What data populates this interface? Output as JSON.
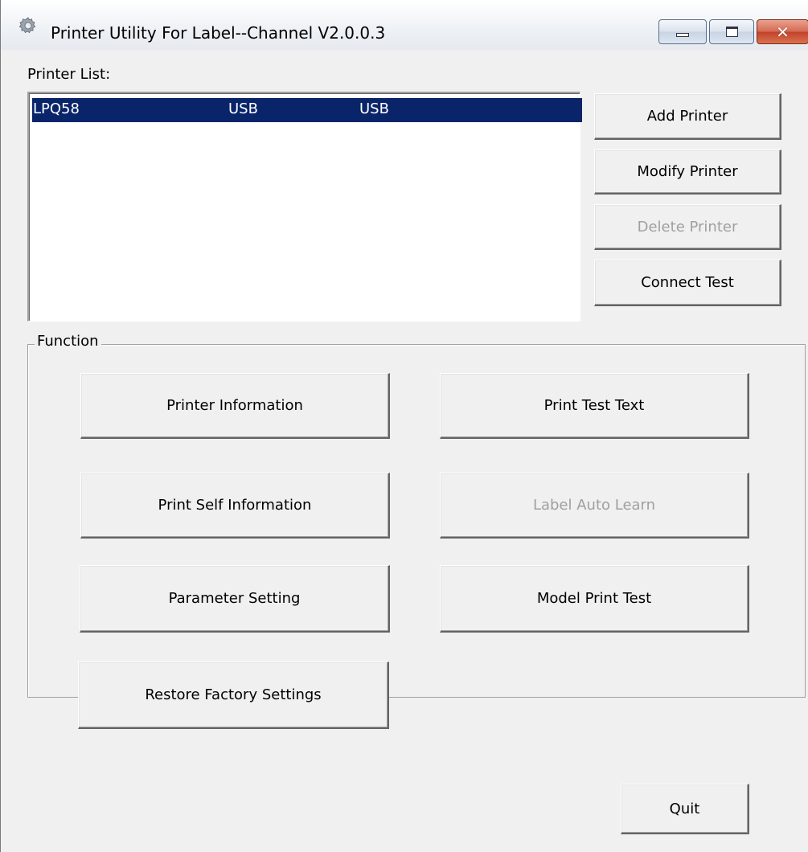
{
  "window": {
    "title": "Printer Utility For Label--Channel  V2.0.0.3",
    "icon": "gear-icon"
  },
  "caption_buttons": {
    "minimize_icon": "minimize-icon",
    "maximize_icon": "maximize-icon",
    "close_glyph": "✕"
  },
  "printer_list": {
    "label": "Printer List:",
    "rows": [
      {
        "name": "LPQ58",
        "port": "USB",
        "type": "USB",
        "selected": true
      }
    ]
  },
  "printer_buttons": {
    "add": "Add Printer",
    "modify": "Modify Printer",
    "delete": "Delete Printer",
    "connect_test": "Connect Test"
  },
  "function": {
    "label": "Function",
    "printer_information": "Printer Information",
    "print_test_text": "Print Test Text",
    "print_self_information": "Print Self Information",
    "label_auto_learn": "Label Auto Learn",
    "parameter_setting": "Parameter Setting",
    "model_print_test": "Model Print Test",
    "restore_factory_settings": "Restore Factory Settings"
  },
  "footer": {
    "quit": "Quit"
  },
  "colors": {
    "selection": "#0a246a",
    "window_bg": "#f0f0f0",
    "disabled_text": "#a0a0a0"
  }
}
